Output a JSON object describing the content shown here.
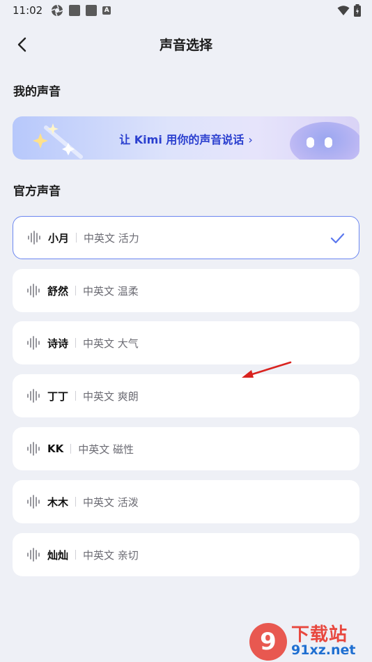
{
  "status_bar": {
    "time": "11:02",
    "app_icon_letter": "A"
  },
  "header": {
    "title": "声音选择",
    "back_icon": "chevron-left-icon"
  },
  "my_voice": {
    "section_title": "我的声音",
    "banner_text": "让 Kimi 用你的声音说话",
    "banner_chevron": "›"
  },
  "official_voice": {
    "section_title": "官方声音",
    "voices": [
      {
        "name": "小月",
        "desc": "中英文 活力",
        "selected": true
      },
      {
        "name": "舒然",
        "desc": "中英文 温柔",
        "selected": false
      },
      {
        "name": "诗诗",
        "desc": "中英文 大气",
        "selected": false
      },
      {
        "name": "丁丁",
        "desc": "中英文 爽朗",
        "selected": false
      },
      {
        "name": "KK",
        "desc": "中英文 磁性",
        "selected": false
      },
      {
        "name": "木木",
        "desc": "中英文 活泼",
        "selected": false
      },
      {
        "name": "灿灿",
        "desc": "中英文 亲切",
        "selected": false
      }
    ]
  },
  "watermark": {
    "badge": "9",
    "title": "下载站",
    "domain": "91xz.net"
  },
  "colors": {
    "accent": "#5b78ee",
    "background": "#eef0f6",
    "annotation_arrow": "#d9231f"
  }
}
